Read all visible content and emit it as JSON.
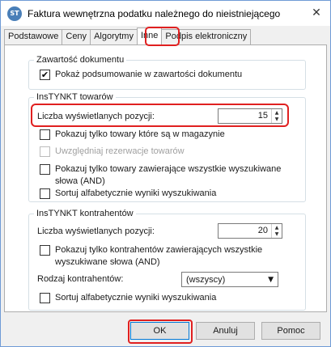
{
  "window": {
    "title": "Faktura wewnętrzna podatku należnego do nieistniejącego",
    "icon_text": "ST",
    "close_icon": "close-icon"
  },
  "tabs": [
    {
      "label": "Podstawowe",
      "active": false
    },
    {
      "label": "Ceny",
      "active": false
    },
    {
      "label": "Algorytmy",
      "active": false
    },
    {
      "label": "Inne",
      "active": true
    },
    {
      "label": "Podpis elektroniczny",
      "active": false
    }
  ],
  "doc_group": {
    "legend": "Zawartość dokumentu",
    "show_summary": {
      "label": "Pokaż podsumowanie w zawartości dokumentu",
      "checked": true
    }
  },
  "towary_group": {
    "legend": "InsTYNKT towarów",
    "count_label": "Liczba wyświetlanych pozycji:",
    "count_value": "15",
    "options": [
      {
        "label": "Pokazuj tylko towary które są w magazynie",
        "checked": false,
        "enabled": true
      },
      {
        "label": "Uwzględniaj rezerwacje towarów",
        "checked": false,
        "enabled": false
      },
      {
        "label": "Pokazuj tylko towary zawierające wszystkie wyszukiwane słowa (AND)",
        "checked": false,
        "enabled": true
      },
      {
        "label": "Sortuj alfabetycznie wyniki wyszukiwania",
        "checked": false,
        "enabled": true
      }
    ]
  },
  "kontrahenci_group": {
    "legend": "InsTYNKT kontrahentów",
    "count_label": "Liczba wyświetlanych pozycji:",
    "count_value": "20",
    "and_option": {
      "label": "Pokazuj tylko kontrahentów zawierających wszystkie wyszukiwane słowa (AND)",
      "checked": false
    },
    "type_label": "Rodzaj kontrahentów:",
    "type_value": "(wszyscy)",
    "sort_option": {
      "label": "Sortuj alfabetycznie wyniki wyszukiwania",
      "checked": false
    }
  },
  "buttons": {
    "ok": "OK",
    "cancel": "Anuluj",
    "help": "Pomoc"
  },
  "colors": {
    "highlight": "#e02020",
    "window_border": "#6f9bd6",
    "default_button_border": "#0078d7"
  }
}
